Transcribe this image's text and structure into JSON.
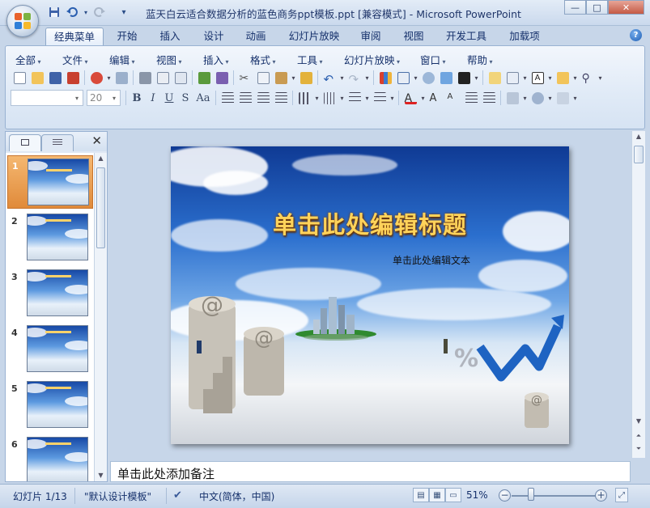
{
  "window": {
    "title": "蓝天白云适合数据分析的蓝色商务ppt模板.ppt [兼容模式] - Microsoft PowerPoint",
    "minimize": "—",
    "maximize": "□",
    "close": "✕"
  },
  "ribbon_tabs": [
    "经典菜单",
    "开始",
    "插入",
    "设计",
    "动画",
    "幻灯片放映",
    "审阅",
    "视图",
    "开发工具",
    "加载项"
  ],
  "menus": [
    "全部",
    "文件",
    "编辑",
    "视图",
    "插入",
    "格式",
    "工具",
    "幻灯片放映",
    "窗口",
    "帮助"
  ],
  "font": {
    "name_value": "",
    "size_value": "20"
  },
  "format_buttons": [
    "B",
    "I",
    "U",
    "S",
    "Aa"
  ],
  "slides_panel": {
    "slides": [
      {
        "number": "1",
        "selected": true
      },
      {
        "number": "2",
        "selected": false
      },
      {
        "number": "3",
        "selected": false
      },
      {
        "number": "4",
        "selected": false
      },
      {
        "number": "5",
        "selected": false
      },
      {
        "number": "6",
        "selected": false
      }
    ]
  },
  "slide": {
    "title": "单击此处编辑标题",
    "subtitle": "单击此处编辑文本"
  },
  "notes": {
    "placeholder": "单击此处添加备注"
  },
  "status": {
    "slide_counter": "幻灯片 1/13",
    "design_template": "\"默认设计模板\"",
    "language": "中文(简体，中国)",
    "zoom": "51%"
  },
  "colors": {
    "accent": "#1d5db4",
    "title_gold": "#ffd35a",
    "selection_orange": "#e08a3a"
  }
}
